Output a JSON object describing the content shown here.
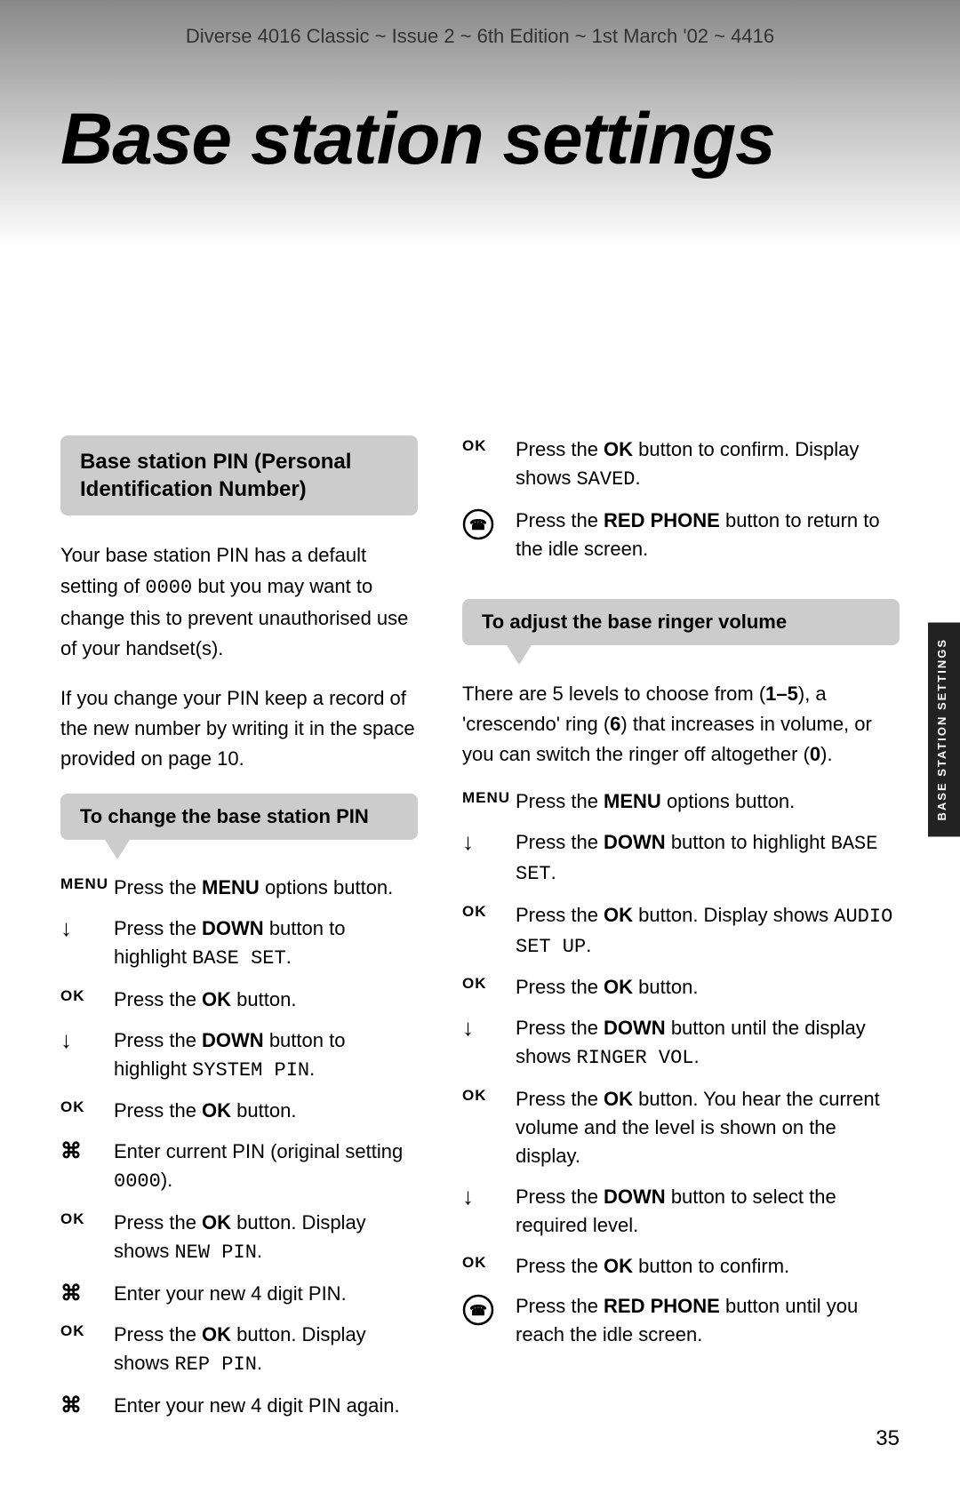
{
  "header": {
    "meta": "Diverse 4016 Classic ~ Issue 2 ~ 6th Edition ~ 1st March '02 ~ 4416",
    "title": "Base station settings"
  },
  "side_tab": "BASE STATION SETTINGS",
  "page_number": "35",
  "left_col": {
    "section_heading": "Base station PIN (Personal Identification Number)",
    "intro_p1": "Your base station PIN has a default setting of 0000 but you may want to change this to prevent unauthorised use of your handset(s).",
    "intro_p2": "If you change your PIN keep a record of the new number by writing it in the space provided on page 10.",
    "callout": "To change the base station PIN",
    "steps": [
      {
        "icon": "MENU",
        "icon_type": "menu",
        "text": "Press the <strong>MENU</strong> options button."
      },
      {
        "icon": "↓",
        "icon_type": "arrow",
        "text": "Press the <strong>DOWN</strong> button to highlight <span class='bold-mono'>BASE SET</span>."
      },
      {
        "icon": "OK",
        "icon_type": "ok",
        "text": "Press the <strong>OK</strong> button."
      },
      {
        "icon": "↓",
        "icon_type": "arrow",
        "text": "Press the <strong>DOWN</strong> button to highlight <span class='bold-mono'>SYSTEM PIN</span>."
      },
      {
        "icon": "OK",
        "icon_type": "ok",
        "text": "Press the <strong>OK</strong> button."
      },
      {
        "icon": "⊞",
        "icon_type": "keypad",
        "text": "Enter current PIN (original setting <span class='bold-mono'>0000</span>)."
      },
      {
        "icon": "OK",
        "icon_type": "ok",
        "text": "Press the <strong>OK</strong> button. Display shows <span class='bold-mono'>NEW PIN</span>."
      },
      {
        "icon": "⊞",
        "icon_type": "keypad",
        "text": "Enter your new 4 digit PIN."
      },
      {
        "icon": "OK",
        "icon_type": "ok",
        "text": "Press the <strong>OK</strong> button. Display shows <span class='bold-mono'>REP PIN</span>."
      },
      {
        "icon": "⊞",
        "icon_type": "keypad",
        "text": "Enter your new 4 digit PIN again."
      }
    ]
  },
  "right_col": {
    "top_steps": [
      {
        "icon": "OK",
        "icon_type": "ok",
        "text": "Press the <strong>OK</strong> button to confirm. Display shows <span class='bold-mono'>SAVED</span>."
      },
      {
        "icon": "⊙",
        "icon_type": "phone",
        "text": "Press the <strong>RED PHONE</strong> button to return to the idle screen."
      }
    ],
    "callout": "To adjust the base ringer volume",
    "intro": "There are 5 levels to choose from (<strong>1–5</strong>), a 'crescendo' ring (<strong>6</strong>) that increases in volume, or you can switch the ringer off altogether (<strong>0</strong>).",
    "steps": [
      {
        "icon": "MENU",
        "icon_type": "menu",
        "text": "Press the <strong>MENU</strong> options button."
      },
      {
        "icon": "↓",
        "icon_type": "arrow",
        "text": "Press the <strong>DOWN</strong> button to highlight <span class='bold-mono'>BASE SET</span>."
      },
      {
        "icon": "OK",
        "icon_type": "ok",
        "text": "Press the <strong>OK</strong> button. Display shows <span class='bold-mono'>AUDIO SET UP</span>."
      },
      {
        "icon": "OK",
        "icon_type": "ok",
        "text": "Press the <strong>OK</strong> button."
      },
      {
        "icon": "↓",
        "icon_type": "arrow",
        "text": "Press the <strong>DOWN</strong> button until the display shows <span class='bold-mono'>RINGER VOL</span>."
      },
      {
        "icon": "OK",
        "icon_type": "ok",
        "text": "Press the <strong>OK</strong> button. You hear the current volume and the level is shown on the display."
      },
      {
        "icon": "↓",
        "icon_type": "arrow",
        "text": "Press the <strong>DOWN</strong> button to select the required level."
      },
      {
        "icon": "OK",
        "icon_type": "ok",
        "text": "Press the <strong>OK</strong> button to confirm."
      },
      {
        "icon": "⊙",
        "icon_type": "phone",
        "text": "Press the <strong>RED PHONE</strong> button until you reach the idle screen."
      }
    ]
  }
}
